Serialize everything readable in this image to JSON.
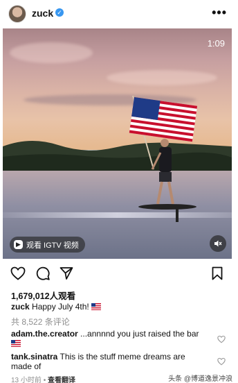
{
  "header": {
    "username": "zuck",
    "verified_glyph": "✓",
    "more_glyph": "•••"
  },
  "media": {
    "duration": "1:09",
    "igtv_label": "观看 IGTV 视频",
    "igtv_glyph": "▶",
    "icons": [
      "play-icon",
      "mute-icon"
    ]
  },
  "actions": {
    "icons": [
      "heart-icon",
      "comment-icon",
      "share-icon",
      "bookmark-icon"
    ]
  },
  "post": {
    "views": "1,679,012人观看",
    "caption_user": "zuck",
    "caption_text": "Happy July 4th!",
    "comment_count": "共 8,522 条评论"
  },
  "comments": [
    {
      "user": "adam.the.creator",
      "text": "...annnnd you just raised the bar",
      "has_flag": true
    },
    {
      "user": "tank.sinatra",
      "text": "This is the stuff meme dreams are",
      "text2": "made of"
    }
  ],
  "footer": {
    "time": "13 小时前",
    "separator": "•",
    "translate": "查看翻译",
    "watermark": "头条 @博道逸景冲浪"
  },
  "colors": {
    "accent": "#3897f0",
    "muted": "#8e8e8e"
  }
}
